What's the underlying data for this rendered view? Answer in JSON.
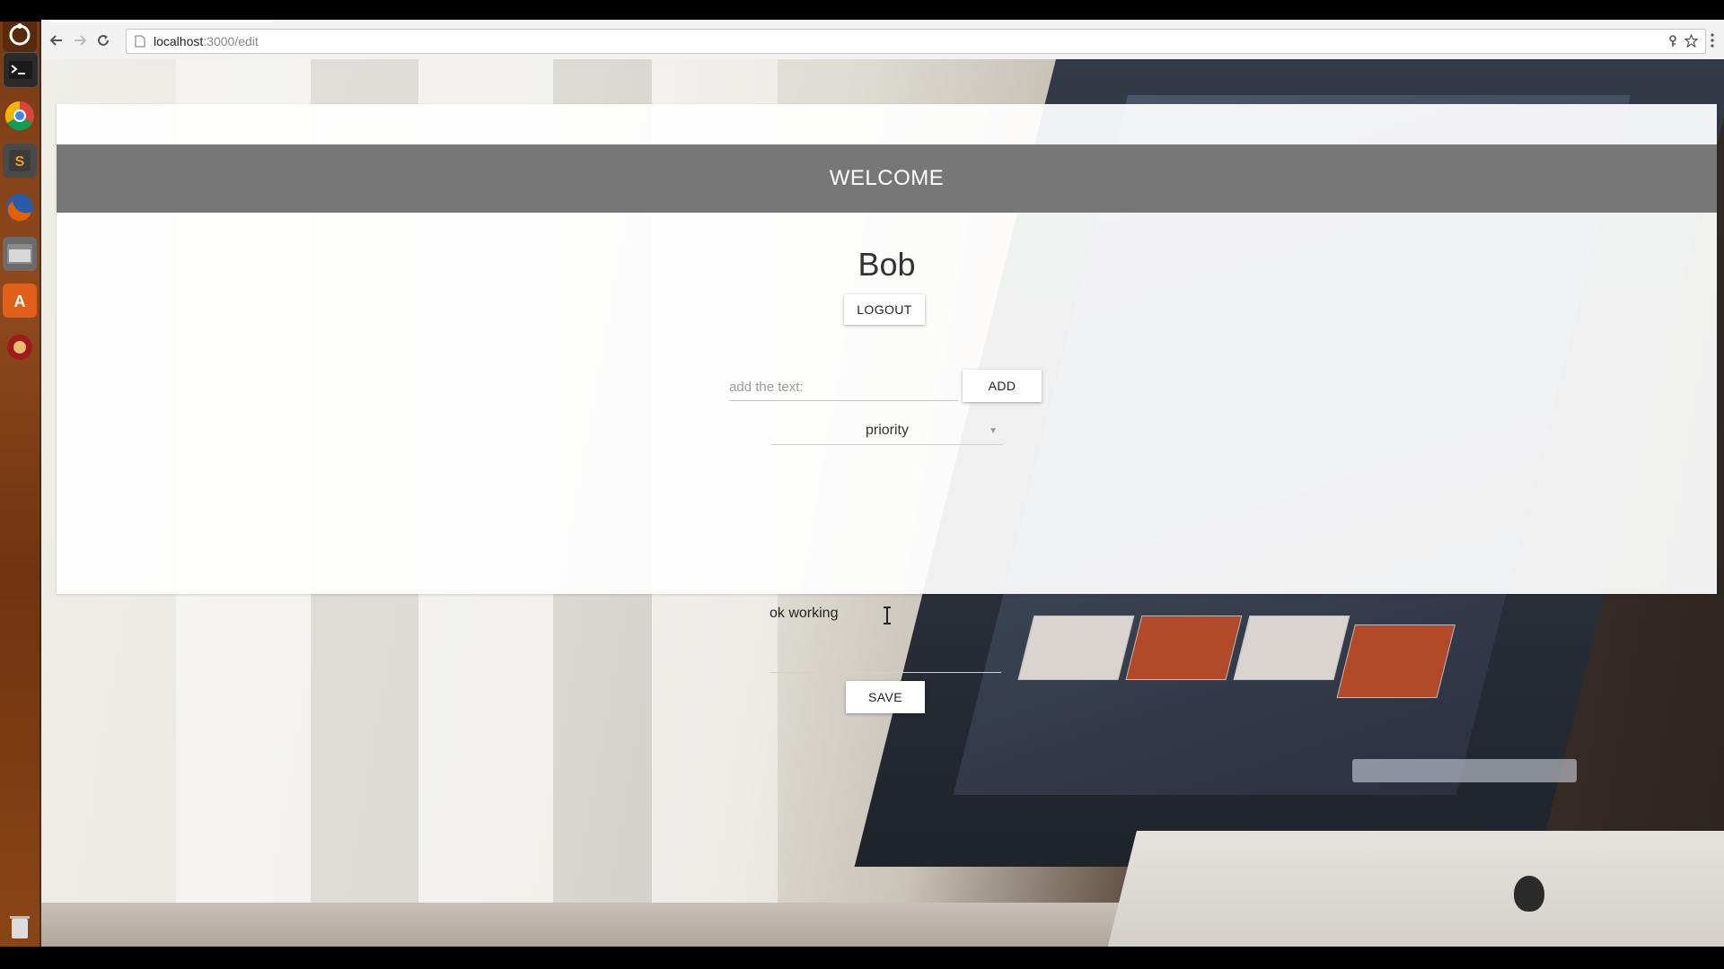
{
  "browser": {
    "url_host": "localhost",
    "url_rest": ":3000/edit"
  },
  "launcher": {
    "icons": [
      "ubuntu-dash-icon",
      "terminal-icon",
      "chrome-icon",
      "sublime-text-icon",
      "firefox-icon",
      "files-icon",
      "software-center-icon",
      "app-icon",
      "trash-icon"
    ]
  },
  "page": {
    "welcome_label": "WELCOME",
    "username": "Bob",
    "logout_label": "LOGOUT",
    "text_input": {
      "placeholder": "add the text:",
      "value": ""
    },
    "add_label": "ADD",
    "priority_select": {
      "selected": "priority"
    },
    "task_text": "ok working",
    "save_label": "SAVE"
  },
  "colors": {
    "welcome_bar": "#777777",
    "card": "#ffffff"
  }
}
